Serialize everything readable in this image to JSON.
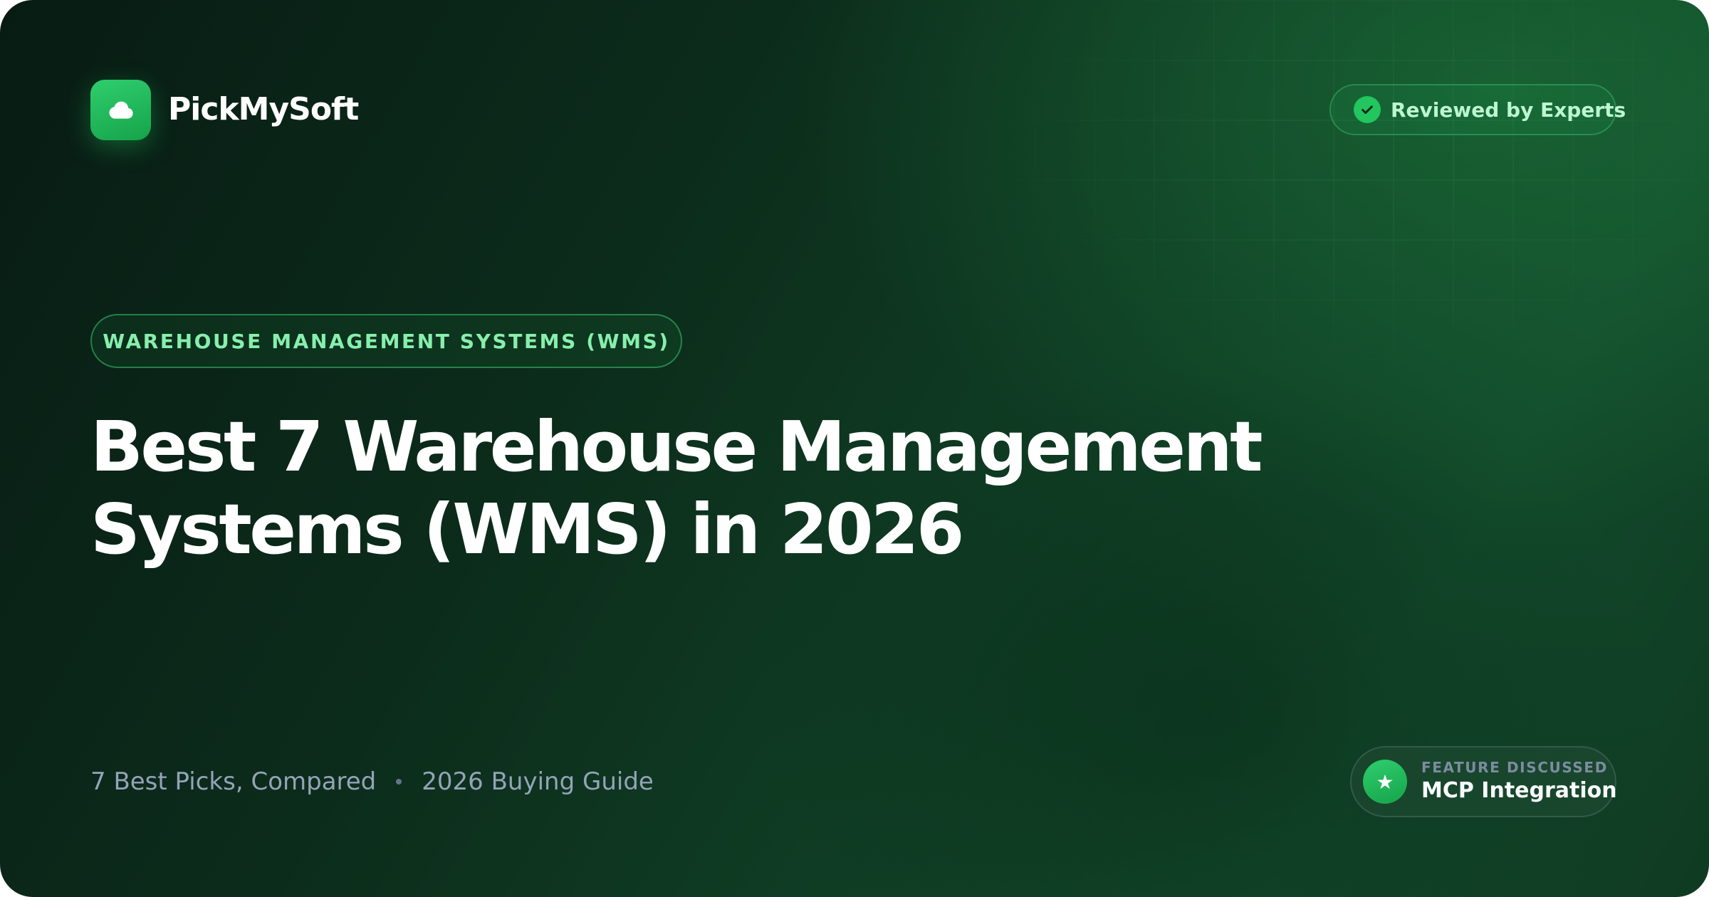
{
  "brand": {
    "name": "PickMySoft",
    "logo_icon": "cloud-icon"
  },
  "badge": {
    "label": "Reviewed by Experts",
    "icon": "check-circle-icon"
  },
  "category": {
    "label": "WAREHOUSE MANAGEMENT SYSTEMS (WMS)"
  },
  "headline": {
    "line1": "Best 7 Warehouse Management",
    "line2": "Systems (WMS) in 2026"
  },
  "meta": {
    "picks": "7 Best Picks, Compared",
    "guide": "2026 Buying Guide"
  },
  "feature": {
    "eyebrow": "FEATURE DISCUSSED",
    "value": "MCP Integration",
    "icon": "star-icon"
  },
  "colors": {
    "accent": "#22c55e",
    "accent_light": "#86efac",
    "background": "#0c2c1b"
  }
}
